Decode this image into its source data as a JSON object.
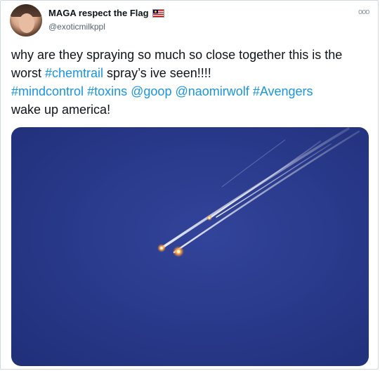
{
  "tweet": {
    "display_name": "MAGA respect the Flag",
    "handle": "@exoticmilkppl",
    "more_label": "ooo",
    "text_parts": {
      "p1": "why are they spraying so much so close together this is the worst ",
      "h1": "#chemtrail",
      "p2": " spray’s ive seen!!!!",
      "h2": "#mindcontrol",
      "h3": "#toxins",
      "h4": "@goop",
      "h5": "@naomirwolf",
      "h6": "#Avengers",
      "p3": "wake up america!"
    }
  },
  "icons": {
    "avatar": "profile-avatar",
    "flag": "malaysia-flag-icon",
    "more": "more-options-icon"
  },
  "colors": {
    "link": "#1b95e0",
    "text": "#0f1419",
    "secondary": "#536471",
    "sky": "#2a3a8c"
  }
}
